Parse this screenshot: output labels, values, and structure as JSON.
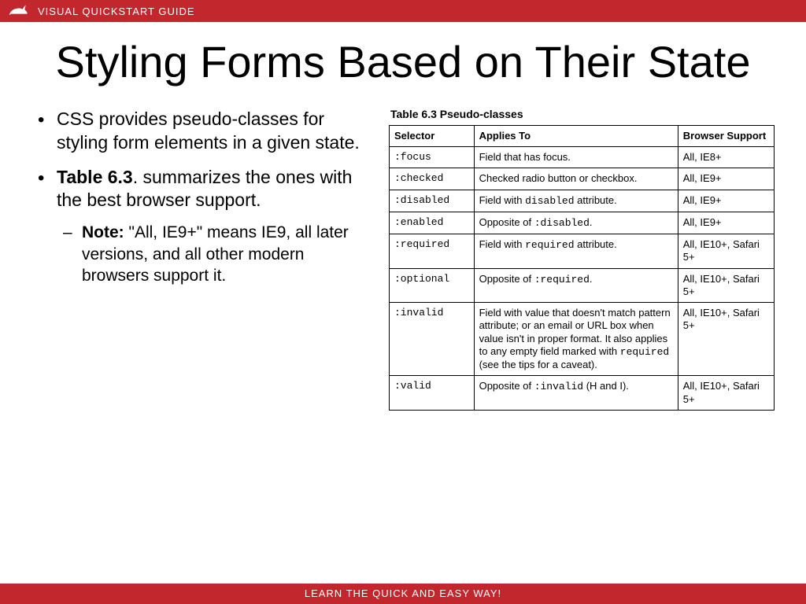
{
  "topbar": {
    "text": "VISUAL QUICKSTART GUIDE"
  },
  "title": "Styling Forms Based on Their State",
  "bullets": {
    "b1": "CSS provides pseudo-classes for styling form elements in a given state.",
    "b2_bold": "Table 6.3",
    "b2_rest": ". summarizes the ones with the best browser support.",
    "sub_bold": "Note:",
    "sub_rest": " \"All, IE9+\" means IE9, all later versions, and all other modern browsers support it."
  },
  "table": {
    "caption": "Table 6.3 Pseudo-classes",
    "head": {
      "c1": "Selector",
      "c2": "Applies To",
      "c3": "Browser Support"
    },
    "rows": {
      "r0": {
        "sel": ":focus",
        "app": "Field that has focus.",
        "sup": "All, IE8+"
      },
      "r1": {
        "sel": ":checked",
        "app": "Checked radio button or checkbox.",
        "sup": "All, IE9+"
      },
      "r2": {
        "sel": ":disabled",
        "app_pre": "Field with ",
        "app_mono": "disabled",
        "app_post": " attribute.",
        "sup": "All, IE9+"
      },
      "r3": {
        "sel": ":enabled",
        "app_pre": "Opposite of ",
        "app_mono": ":disabled",
        "app_post": ".",
        "sup": "All, IE9+"
      },
      "r4": {
        "sel": ":required",
        "app_pre": "Field with ",
        "app_mono": "required",
        "app_post": " attribute.",
        "sup": "All, IE10+, Safari 5+"
      },
      "r5": {
        "sel": ":optional",
        "app_pre": "Opposite of ",
        "app_mono": ":required",
        "app_post": ".",
        "sup": "All, IE10+, Safari 5+"
      },
      "r6": {
        "sel": ":invalid",
        "app_pre": "Field with value that doesn't match pattern attribute; or an email or URL box when value isn't in proper format. It also applies to any empty field marked with ",
        "app_mono": "required",
        "app_post": " (see the tips for a caveat).",
        "sup": "All, IE10+, Safari 5+"
      },
      "r7": {
        "sel": ":valid",
        "app_pre": "Opposite of ",
        "app_mono": ":invalid",
        "app_post": " (H and I).",
        "sup": "All, IE10+, Safari 5+"
      }
    }
  },
  "footer": {
    "text": "LEARN THE QUICK AND EASY WAY!"
  }
}
